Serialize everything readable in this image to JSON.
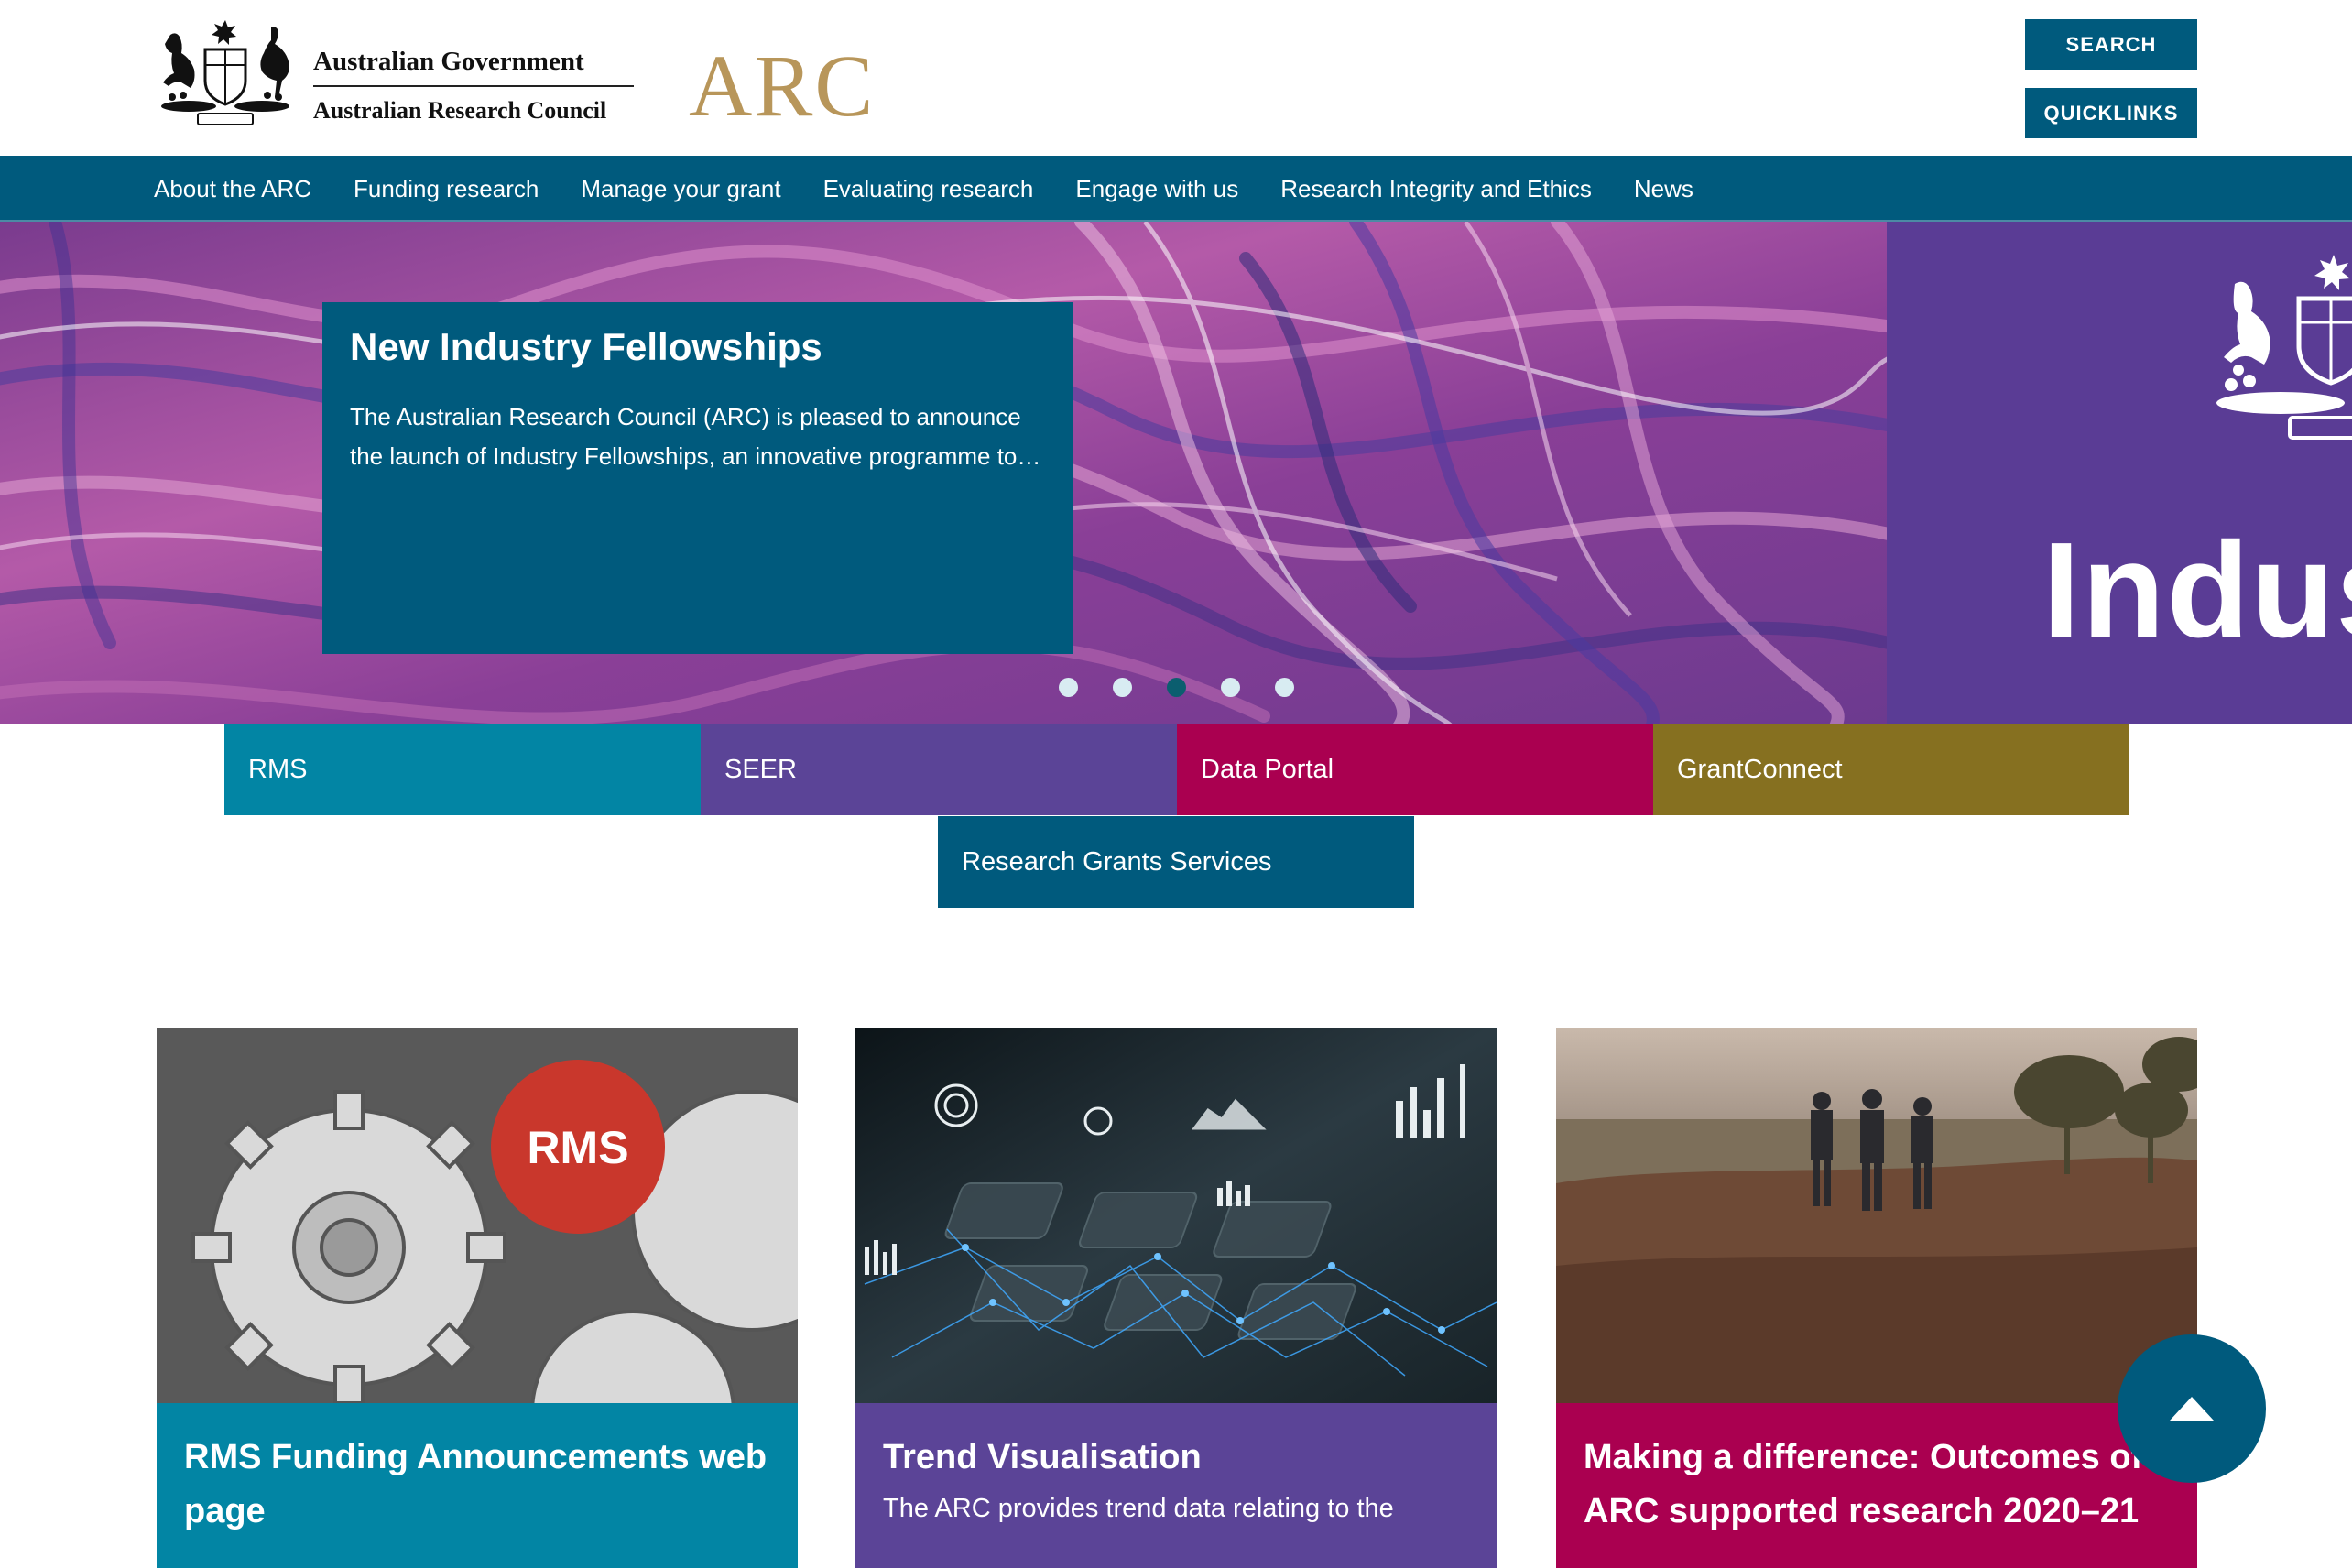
{
  "header": {
    "gov_line1": "Australian Government",
    "gov_line2": "Australian Research Council",
    "arc_logo": "ARC",
    "search_label": "SEARCH",
    "quicklinks_label": "QUICKLINKS"
  },
  "nav": {
    "items": [
      {
        "label": "About the ARC"
      },
      {
        "label": "Funding research"
      },
      {
        "label": "Manage your grant"
      },
      {
        "label": "Evaluating research"
      },
      {
        "label": "Engage with us"
      },
      {
        "label": "Research Integrity and Ethics"
      },
      {
        "label": "News"
      }
    ]
  },
  "hero": {
    "title": "New Industry Fellowships",
    "body": "The Australian Research Council (ARC) is pleased to announce the launch of Industry Fellowships, an innovative programme to…",
    "next_slide_text": "Indus",
    "slide_count": 5,
    "active_slide": 3
  },
  "quicklinks": {
    "rms": "RMS",
    "seer": "SEER",
    "data_portal": "Data Portal",
    "grantconnect": "GrantConnect",
    "rgs": "Research Grants Services"
  },
  "cards": [
    {
      "title": "RMS Funding Announcements web page",
      "image_badge": "RMS",
      "text": ""
    },
    {
      "title": "Trend Visualisation",
      "text": "The ARC provides trend data relating to the"
    },
    {
      "title": "Making a difference: Outcomes of ARC supported research 2020–21",
      "text": ""
    }
  ],
  "colors": {
    "primary": "#005a7d",
    "teal": "#0285a4",
    "purple": "#5b4497",
    "magenta": "#aa0050",
    "olive": "#867020",
    "gold": "#b8965a"
  }
}
